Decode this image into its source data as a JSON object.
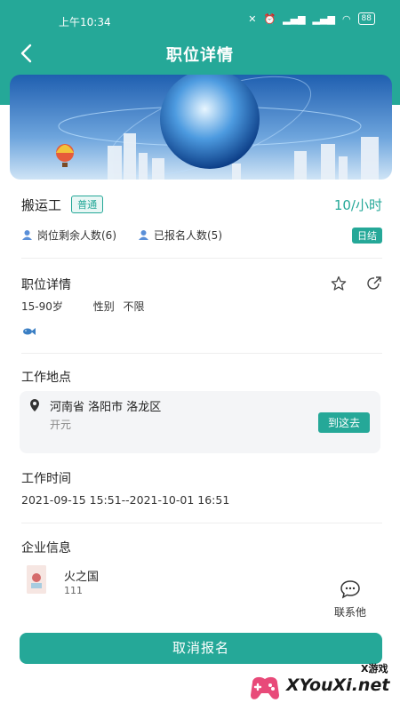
{
  "status": {
    "time": "上午10:34",
    "battery": "88"
  },
  "nav": {
    "title": "职位详情"
  },
  "job": {
    "name": "搬运工",
    "tag": "普通",
    "wage": "10/小时",
    "remaining_label": "岗位剩余人数(6)",
    "registered_label": "已报名人数(5)",
    "pay_type": "日结"
  },
  "details": {
    "title": "职位详情",
    "age": "15-90岁",
    "gender_label": "性别",
    "gender_value": "不限"
  },
  "location": {
    "title": "工作地点",
    "address": "河南省 洛阳市 洛龙区",
    "sub": "开元",
    "goto_label": "到这去"
  },
  "worktime": {
    "title": "工作时间",
    "range": "2021-09-15 15:51--2021-10-01 16:51"
  },
  "company": {
    "title": "企业信息",
    "name": "火之国",
    "code": "111",
    "contact_label": "联系他"
  },
  "action": {
    "cancel_label": "取消报名"
  },
  "watermark": {
    "small": "X游戏",
    "large": "XYouXi.net"
  },
  "colors": {
    "primary": "#25a898",
    "text": "#222222"
  }
}
